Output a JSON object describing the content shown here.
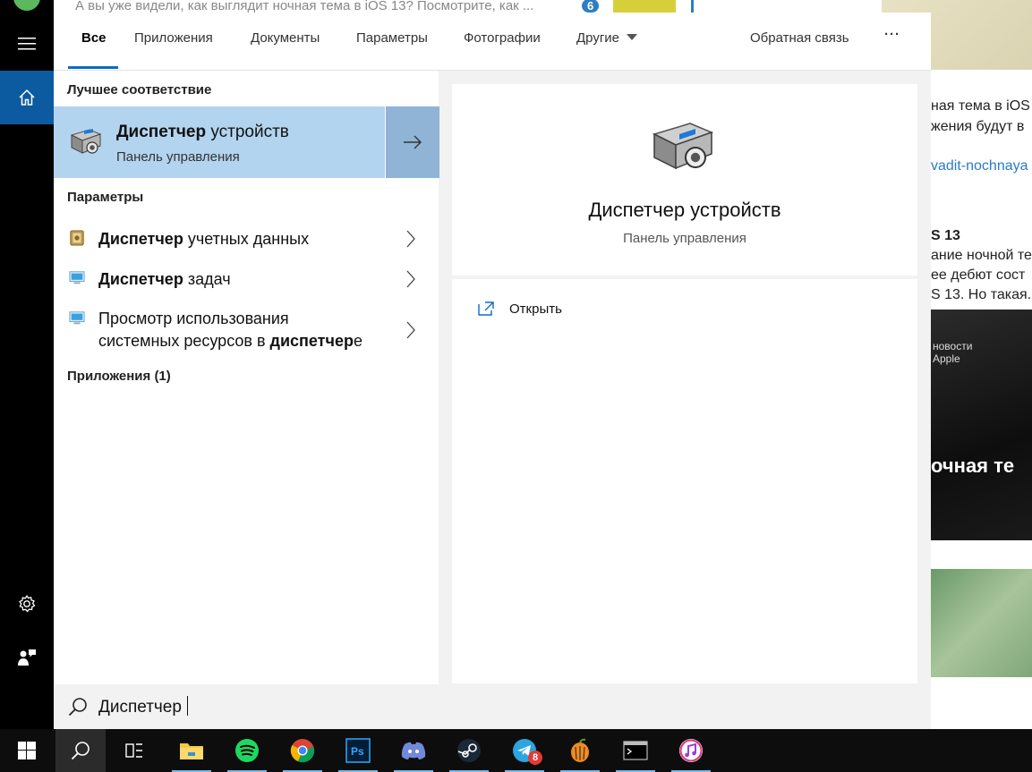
{
  "background_page": {
    "top_snippet": "А вы уже видели, как выглядит ночная тема в iOS 13? Посмотрите, как ...",
    "top_badge": "6",
    "right_text_lines": [
      "ная тема в iOS",
      "жения будут в"
    ],
    "right_link": "vadit-nochnaya",
    "right_heading": "S 13",
    "right_paragraph": [
      "ание ночной те",
      "ее дебют сост",
      "S 13. Но такая..."
    ],
    "image_caption": [
      "новости",
      "Apple"
    ],
    "image_big_text": "очная те"
  },
  "rail": {
    "menu_icon": "hamburger-icon",
    "home_icon": "home-icon",
    "settings_icon": "gear-icon",
    "feedback_icon": "person-feedback-icon"
  },
  "tabs": {
    "all": "Все",
    "apps": "Приложения",
    "documents": "Документы",
    "settings": "Параметры",
    "photos": "Фотографии",
    "more": "Другие",
    "feedback": "Обратная связь",
    "ellipsis": "···"
  },
  "results": {
    "best_match_heading": "Лучшее соответствие",
    "best_match": {
      "title_bold": "Диспетчер",
      "title_rest": " устройств",
      "subtitle": "Панель управления"
    },
    "settings_heading": "Параметры",
    "settings_items": [
      {
        "bold": "Диспетчер",
        "rest": " учетных данных"
      },
      {
        "bold": "Диспетчер",
        "rest": " задач"
      },
      {
        "line1": "Просмотр использования",
        "line2_pre": "системных ресурсов в ",
        "line2_bold": "диспетчер",
        "line2_post": "е"
      }
    ],
    "apps_heading": "Приложения (1)"
  },
  "preview": {
    "title": "Диспетчер устройств",
    "subtitle": "Панель управления",
    "open_label": "Открыть"
  },
  "search": {
    "query": "Диспетчер"
  },
  "taskbar": {
    "telegram_badge": "8"
  }
}
